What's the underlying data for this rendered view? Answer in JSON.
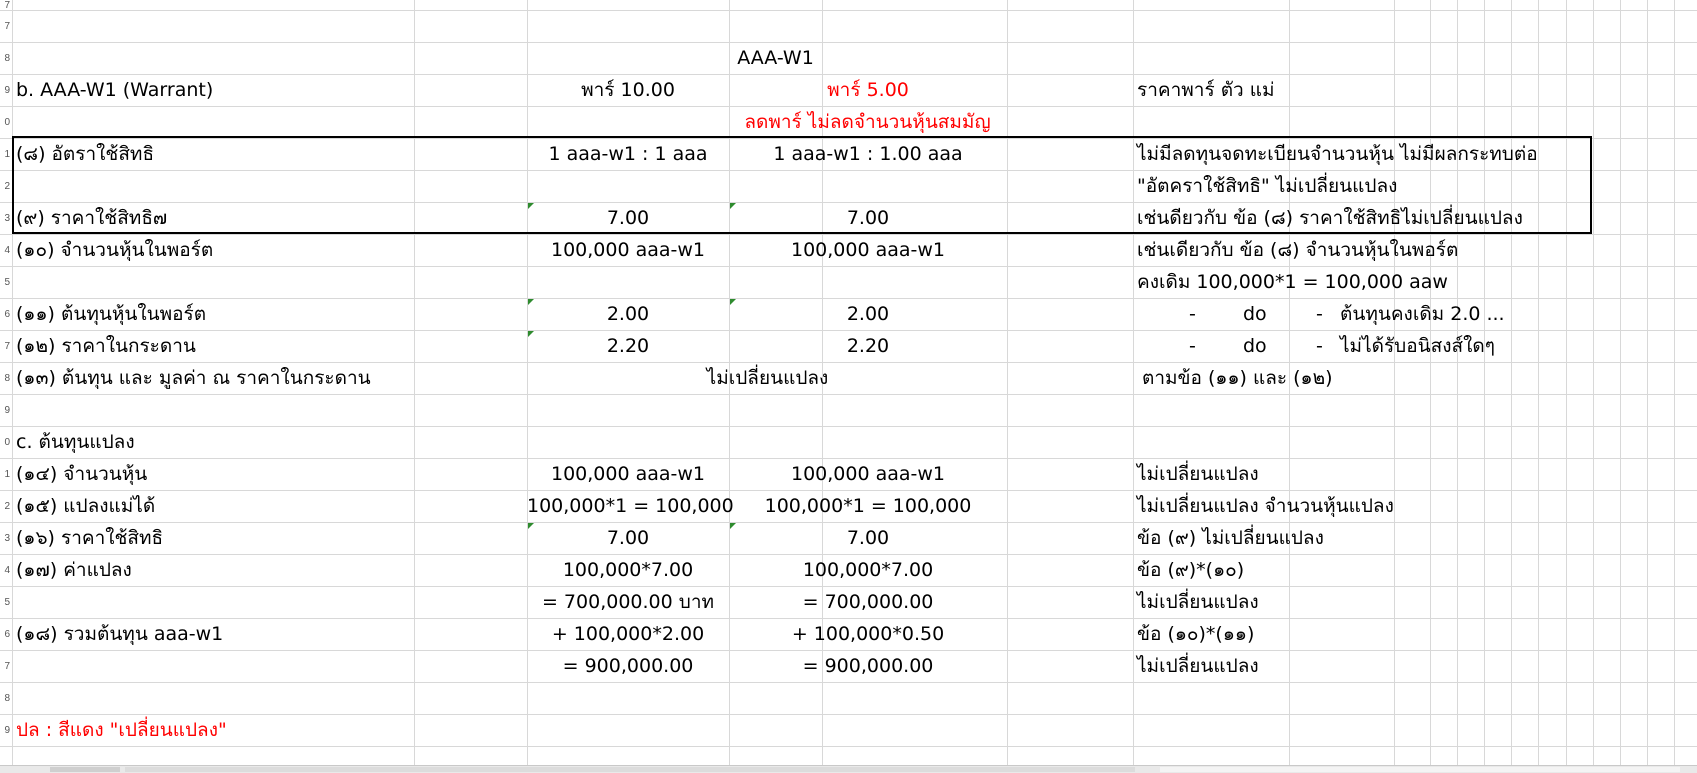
{
  "rows": {
    "r7": "7",
    "r8": "8",
    "r9": "9",
    "r10": "0",
    "r11": "1",
    "r12": "2",
    "r13": "3",
    "r14": "4",
    "r15": "5",
    "r16": "6",
    "r17": "7",
    "r18": "8",
    "r19": "9",
    "r20": "0",
    "r21": "1",
    "r22": "2",
    "r23": "3",
    "r24": "4",
    "r25": "5",
    "r26": "6",
    "r27": "7",
    "r28": "8",
    "r29": "9"
  },
  "header": {
    "title": "AAA-W1",
    "section_b": "b. AAA-W1 (Warrant)",
    "par_old": "พาร์ 10.00",
    "par_new": "พาร์ 5.00",
    "par_note": "ราคาพาร์ ตัว แม่",
    "subtitle": "ลดพาร์ ไม่ลดจำนวนหุ้นสมมัญ"
  },
  "items": {
    "r8_label": "(๘) อัตราใช้สิทธิ",
    "r8_old": "1 aaa-w1 : 1 aaa",
    "r8_new": "1 aaa-w1 : 1.00 aaa",
    "r8_note1": "ไม่มีลดทุนจดทะเบียนจำนวนหุ้น ไม่มีผลกระทบต่อ",
    "r8_note2": "\"อัตคราใช้สิทธิ\" ไม่เปลี่ยนแปลง",
    "r9_label": "(๙) ราคาใช้สิทธิ๗",
    "r9_old": "7.00",
    "r9_new": "7.00",
    "r9_note": "เช่นดียวกับ ข้อ (๘) ราคาใช้สิทธิไม่เปลี่ยนแปลง",
    "r10_label": "(๑๐) จำนวนหุ้นในพอร์ต",
    "r10_old": "100,000 aaa-w1",
    "r10_new": "100,000 aaa-w1",
    "r10_note1": "เช่นเดียวกับ ข้อ (๘) จำนวนหุ้นในพอร์ต",
    "r10_note2": "คงเดิม 100,000*1 = 100,000 aaw",
    "r11_label": "(๑๑) ต้นทุนหุ้นในพอร์ต",
    "r11_old": "2.00",
    "r11_new": "2.00",
    "r11_dash1": "-",
    "r11_do": "do",
    "r11_dash2": "-",
    "r11_note": "ต้นทุนคงเดิม 2.0 ...",
    "r12_label": "(๑๒) ราคาในกระดาน",
    "r12_old": "2.20",
    "r12_new": "2.20",
    "r12_dash1": "-",
    "r12_do": "do",
    "r12_dash2": "-",
    "r12_note": "ไม่ได้รับอนิสงส์ใดๆ",
    "r13_label": "(๑๓) ต้นทุน และ มูลค่า ณ ราคาในกระดาน",
    "r13_value": "ไม่เปลี่ยนแปลง",
    "r13_note": "ตามข้อ (๑๑) และ (๑๒)"
  },
  "section_c": {
    "title": "c. ต้นทุนแปลง",
    "r14_label": "(๑๔) จำนวนหุ้น",
    "r14_old": "100,000 aaa-w1",
    "r14_new": "100,000 aaa-w1",
    "r14_note": "ไม่เปลี่ยนแปลง",
    "r15_label": "(๑๕) แปลงแม่ได้",
    "r15_old": "100,000*1 = 100,000",
    "r15_new": "100,000*1 = 100,000",
    "r15_note": "ไม่เปลี่ยนแปลง จำนวนหุ้นแปลง",
    "r16_label": "(๑๖) ราคาใช้สิทธิ",
    "r16_old": "7.00",
    "r16_new": "7.00",
    "r16_note": "ข้อ (๙) ไม่เปลี่ยนแปลง",
    "r17_label": "(๑๗) ค่าแปลง",
    "r17_old": "100,000*7.00",
    "r17_new": "100,000*7.00",
    "r17_note": "ข้อ (๙)*(๑๐)",
    "r17b_old": "= 700,000.00 บาท",
    "r17b_new": "= 700,000.00",
    "r17b_note": "ไม่เปลี่ยนแปลง",
    "r18_label": "(๑๘) รวมต้นทุน aaa-w1",
    "r18_old": "+ 100,000*2.00",
    "r18_new": "+ 100,000*0.50",
    "r18_note": "ข้อ (๑๐)*(๑๑)",
    "r18b_old": "= 900,000.00",
    "r18b_new": "= 900,000.00",
    "r18b_note": "ไม่เปลี่ยนแปลง"
  },
  "footer": {
    "legend": "ปล :  สีแดง \"เปลี่ยนแปลง\""
  },
  "colors": {
    "changed": "#ff0000",
    "gridline": "#d8d8d8",
    "error_marker": "#2e8b2e"
  }
}
